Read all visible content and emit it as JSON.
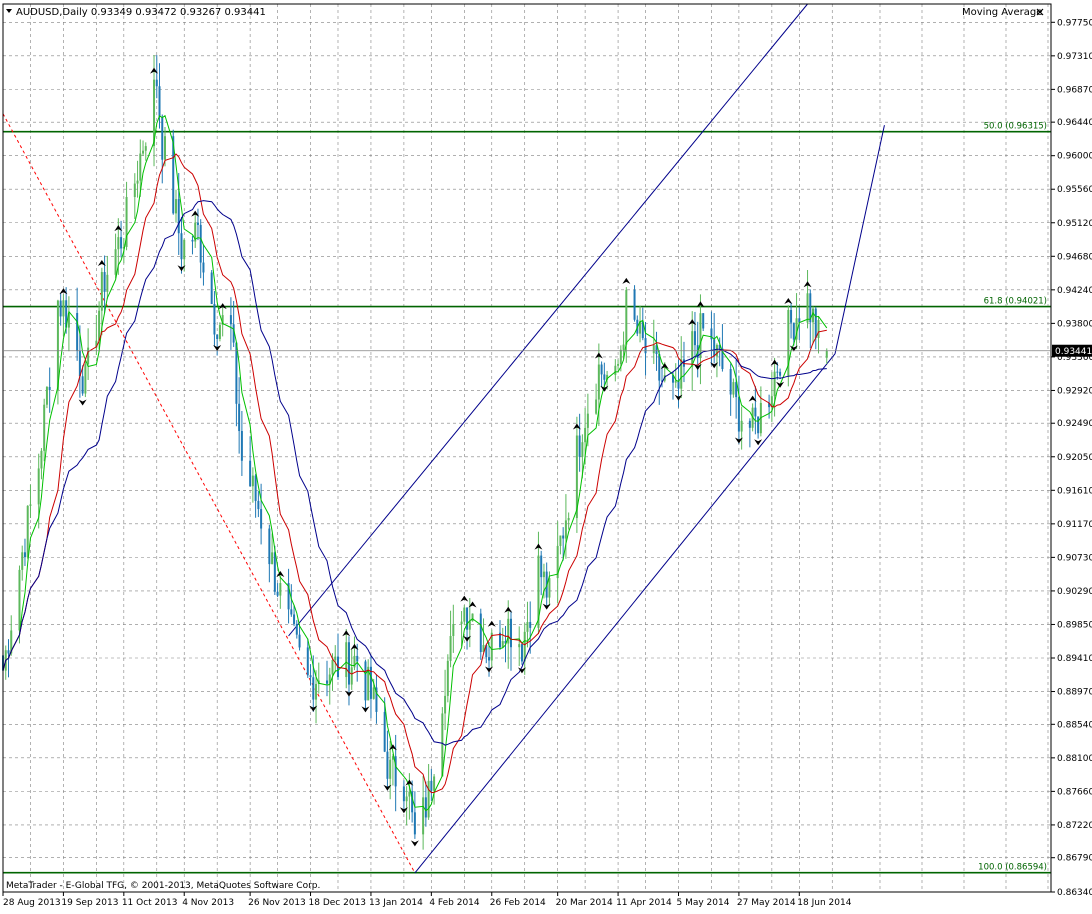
{
  "header": {
    "symbol_line": "AUDUSD,Daily  0.93349 0.93472 0.93267 0.93441",
    "indicator_label": "Moving Average",
    "close_icon": "close-icon",
    "dropdown_icon": "chevron-down-icon"
  },
  "copyright": "MetaTrader - E-Global TFG, © 2001-2013, MetaQuotes Software Corp.",
  "colors": {
    "background": "#ffffff",
    "grid": "#808080",
    "bull_candle": "#5cb85c",
    "bear_candle": "#1f78b4",
    "ma_fast": "#00c000",
    "ma_mid": "#cc0000",
    "ma_slow": "#00008b",
    "fibo_level": "#006400",
    "fibo_line": "#ff0000",
    "channel": "#00008b",
    "price_tag_bg": "#000000",
    "price_tag_fg": "#ffffff"
  },
  "chart_data": {
    "type": "candlestick",
    "title": "AUDUSD,Daily",
    "ohlc_last": {
      "open": 0.93349,
      "high": 0.93472,
      "low": 0.93267,
      "close": 0.93441
    },
    "current_price_label": "0.93441",
    "ylim": [
      0.8634,
      0.9799
    ],
    "y_ticks": [
      "0.97750",
      "0.97310",
      "0.96870",
      "0.96440",
      "0.96000",
      "0.95560",
      "0.95120",
      "0.94680",
      "0.94240",
      "0.93800",
      "0.93360",
      "0.92920",
      "0.92490",
      "0.92050",
      "0.91610",
      "0.91170",
      "0.90730",
      "0.90290",
      "0.89850",
      "0.89410",
      "0.88970",
      "0.88540",
      "0.88100",
      "0.87660",
      "0.87220",
      "0.86790",
      "0.86340"
    ],
    "x_ticks": [
      "28 Aug 2013",
      "19 Sep 2013",
      "11 Oct 2013",
      "4 Nov 2013",
      "26 Nov 2013",
      "18 Dec 2013",
      "13 Jan 2014",
      "4 Feb 2014",
      "26 Feb 2014",
      "20 Mar 2014",
      "11 Apr 2014",
      "5 May 2014",
      "27 May 2014",
      "18 Jun 2014"
    ],
    "x_range": [
      "2013-08-27",
      "2014-06-26"
    ],
    "grid": true,
    "fibonacci": {
      "levels": [
        {
          "label": "50.0 (0.96315)",
          "value": 0.96315
        },
        {
          "label": "61.8 (0.94021)",
          "value": 0.94021
        },
        {
          "label": "100.0 (0.86594)",
          "value": 0.86594
        }
      ],
      "trend_from": {
        "date": "2013-08-27",
        "price": 0.9655
      },
      "trend_to": {
        "date": "2014-01-24",
        "price": 0.8659
      }
    },
    "channel_lines": [
      {
        "from": {
          "date": "2013-12-09",
          "price": 0.897
        },
        "to": {
          "date": "2014-06-16",
          "price": 0.9799
        }
      },
      {
        "from": {
          "date": "2014-01-24",
          "price": 0.8659
        },
        "to": {
          "date": "2014-06-26",
          "price": 0.934
        }
      },
      {
        "from": {
          "date": "2014-06-26",
          "price": 0.934
        },
        "to": {
          "date": "2014-07-14",
          "price": 0.964
        }
      }
    ],
    "price_anchors": [
      [
        "2013-08-27",
        0.8925
      ],
      [
        "2013-09-02",
        0.906
      ],
      [
        "2013-09-09",
        0.9195
      ],
      [
        "2013-09-16",
        0.941
      ],
      [
        "2013-09-20",
        0.939
      ],
      [
        "2013-09-26",
        0.93
      ],
      [
        "2013-10-03",
        0.944
      ],
      [
        "2013-10-10",
        0.95
      ],
      [
        "2013-10-16",
        0.96
      ],
      [
        "2013-10-22",
        0.97
      ],
      [
        "2013-10-24",
        0.962
      ],
      [
        "2013-10-31",
        0.948
      ],
      [
        "2013-11-06",
        0.95
      ],
      [
        "2013-11-12",
        0.939
      ],
      [
        "2013-11-18",
        0.937
      ],
      [
        "2013-11-22",
        0.92
      ],
      [
        "2013-11-28",
        0.914
      ],
      [
        "2013-12-04",
        0.905
      ],
      [
        "2013-12-10",
        0.897
      ],
      [
        "2013-12-16",
        0.891
      ],
      [
        "2013-12-20",
        0.892
      ],
      [
        "2013-12-27",
        0.893
      ],
      [
        "2014-01-03",
        0.894
      ],
      [
        "2014-01-09",
        0.888
      ],
      [
        "2014-01-15",
        0.879
      ],
      [
        "2014-01-21",
        0.878
      ],
      [
        "2014-01-24",
        0.87
      ],
      [
        "2014-01-29",
        0.876
      ],
      [
        "2014-02-04",
        0.892
      ],
      [
        "2014-02-10",
        0.901
      ],
      [
        "2014-02-14",
        0.9
      ],
      [
        "2014-02-20",
        0.895
      ],
      [
        "2014-02-26",
        0.899
      ],
      [
        "2014-03-04",
        0.896
      ],
      [
        "2014-03-10",
        0.906
      ],
      [
        "2014-03-14",
        0.902
      ],
      [
        "2014-03-20",
        0.913
      ],
      [
        "2014-03-26",
        0.925
      ],
      [
        "2014-04-01",
        0.932
      ],
      [
        "2014-04-07",
        0.93
      ],
      [
        "2014-04-11",
        0.94
      ],
      [
        "2014-04-17",
        0.935
      ],
      [
        "2014-04-23",
        0.931
      ],
      [
        "2014-04-29",
        0.928
      ],
      [
        "2014-05-05",
        0.935
      ],
      [
        "2014-05-09",
        0.937
      ],
      [
        "2014-05-15",
        0.933
      ],
      [
        "2014-05-21",
        0.927
      ],
      [
        "2014-05-27",
        0.924
      ],
      [
        "2014-06-02",
        0.929
      ],
      [
        "2014-06-06",
        0.934
      ],
      [
        "2014-06-10",
        0.938
      ],
      [
        "2014-06-13",
        0.94
      ],
      [
        "2014-06-16",
        0.941
      ],
      [
        "2014-06-20",
        0.936
      ],
      [
        "2014-06-23",
        0.9344
      ]
    ],
    "series": [
      {
        "name": "",
        "role": "fast",
        "values": []
      },
      {
        "name": "",
        "role": "mid",
        "values": []
      },
      {
        "name": "",
        "role": "slow",
        "values": []
      }
    ],
    "fractal_markers": "up/down arrow markers at swing highs and lows"
  }
}
